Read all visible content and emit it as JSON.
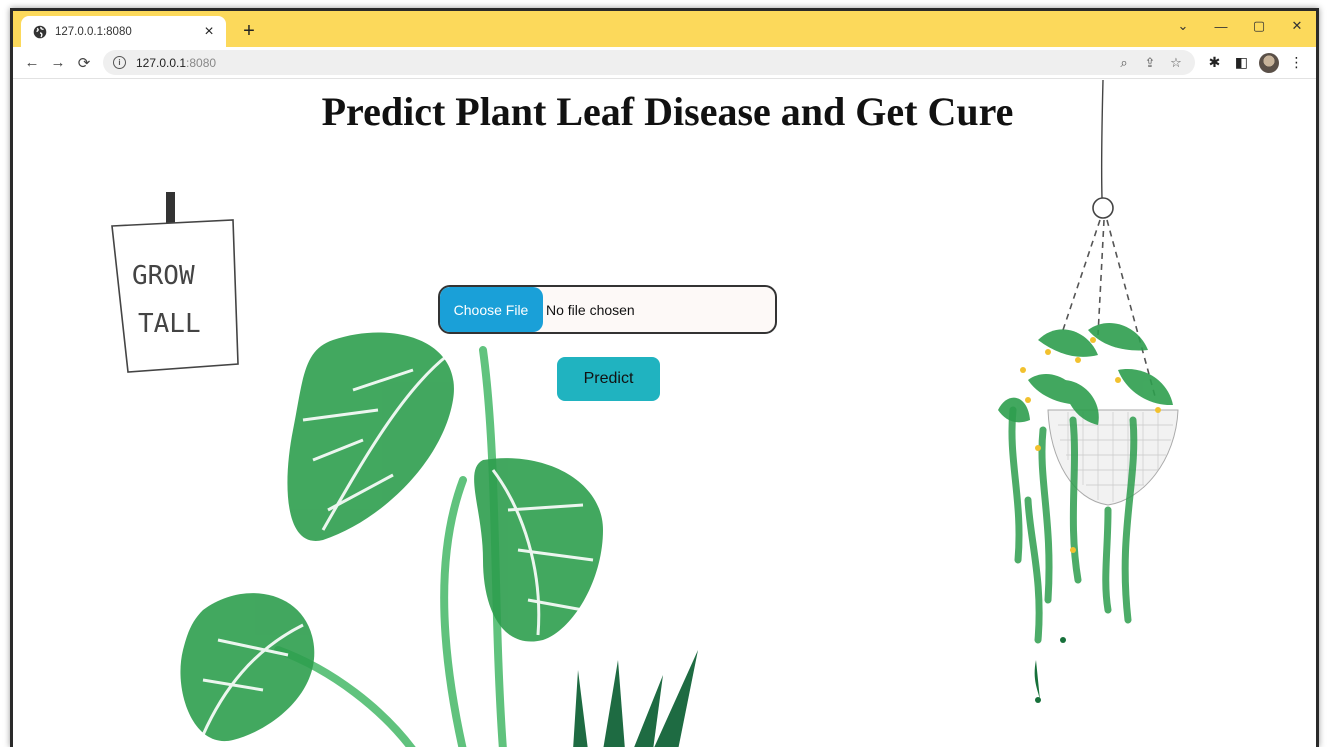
{
  "browser": {
    "tab_title": "127.0.0.1:8080",
    "tab_close": "×",
    "new_tab": "+",
    "url_host": "127.0.0.1",
    "url_port": ":8080",
    "window_controls": [
      "⌄",
      "—",
      "▢",
      "✕"
    ]
  },
  "page": {
    "title": "Predict Plant Leaf Disease and Get Cure",
    "file_input": {
      "button_label": "Choose File",
      "status": "No file chosen"
    },
    "predict_label": "Predict",
    "sign_text": [
      "GROW",
      "TALL"
    ]
  },
  "colors": {
    "tab_strip": "#fcd95b",
    "choose_file_bg": "#1aa0d8",
    "predict_bg": "#20b3c0",
    "leaf_green": "#2e9e4e",
    "leaf_dark": "#17703a"
  }
}
